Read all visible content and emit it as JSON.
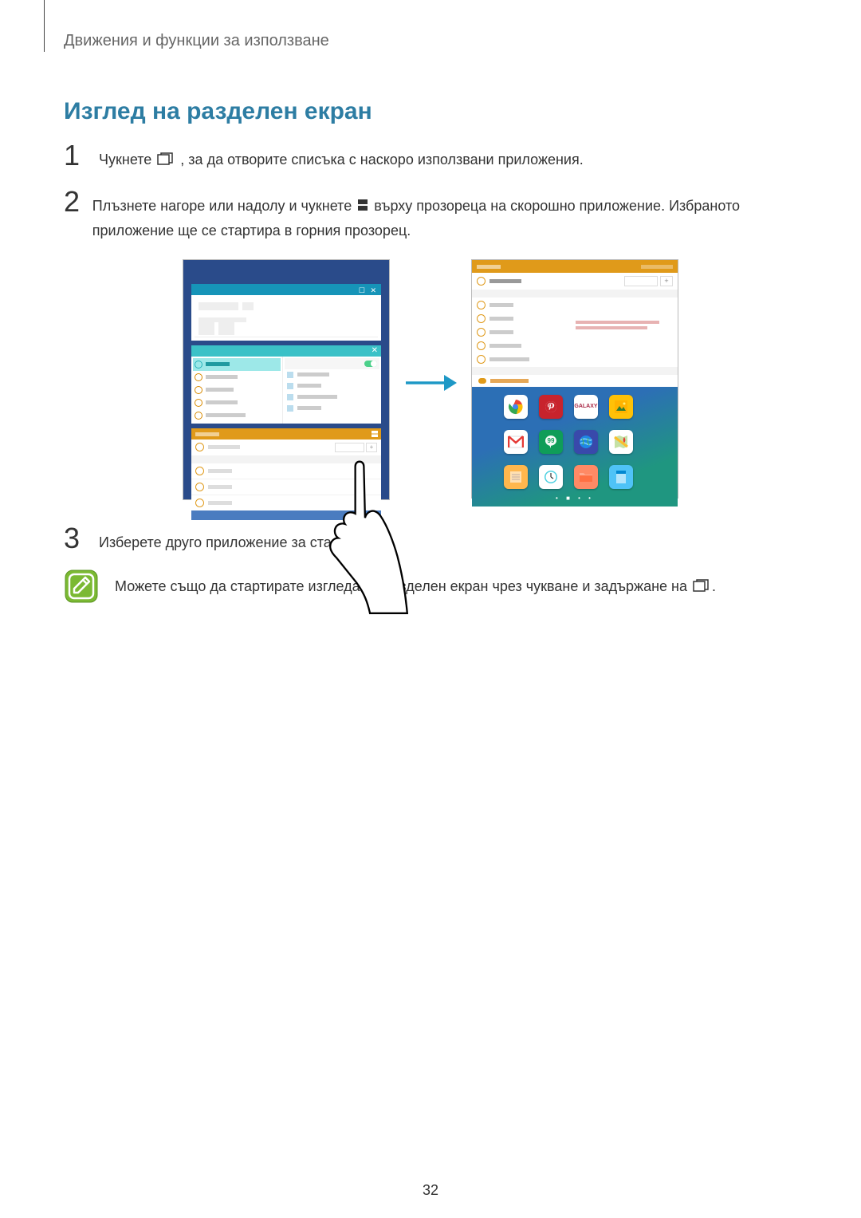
{
  "breadcrumb": "Движения и функции за използване",
  "section_title": "Изглед на разделен екран",
  "steps": {
    "s1": {
      "num": "1",
      "part1": "Чукнете ",
      "part2": ", за да отворите списъка с наскоро използвани приложения."
    },
    "s2": {
      "num": "2",
      "part1": "Плъзнете нагоре или надолу и чукнете ",
      "part2": " върху прозореца на скорошно приложение. Избраното приложение ще се стартира в горния прозорец."
    },
    "s3": {
      "num": "3",
      "text": "Изберете друго приложение за стартиране."
    }
  },
  "note": {
    "part1": "Можете също да стартирате изгледа на разделен екран чрез чукване и задържане на ",
    "part2": "."
  },
  "page_number": "32"
}
